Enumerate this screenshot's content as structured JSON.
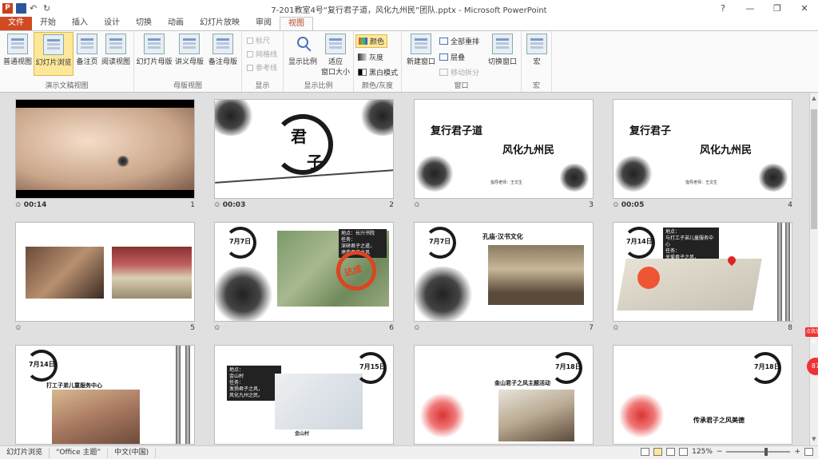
{
  "window": {
    "title": "7-201教室4号“复行君子道，风化九州民”团队.pptx - Microsoft PowerPoint",
    "controls": [
      "?",
      "—",
      "❐",
      "✕"
    ]
  },
  "tabs": [
    {
      "label": "文件"
    },
    {
      "label": "开始"
    },
    {
      "label": "插入"
    },
    {
      "label": "设计"
    },
    {
      "label": "切换"
    },
    {
      "label": "动画"
    },
    {
      "label": "幻灯片放映"
    },
    {
      "label": "审阅"
    },
    {
      "label": "视图"
    }
  ],
  "ribbon": {
    "presentation_views": {
      "label": "演示文稿视图",
      "buttons": [
        "普通视图",
        "幻灯片浏览",
        "备注页",
        "阅读视图"
      ]
    },
    "master_views": {
      "label": "母版视图",
      "buttons": [
        "幻灯片母版",
        "讲义母版",
        "备注母版"
      ]
    },
    "show": {
      "label": "显示",
      "checkboxes": [
        "标尺",
        "网格线",
        "参考线"
      ]
    },
    "zoom": {
      "label": "显示比例",
      "zoom_label": "显示比例",
      "fit_label": "适应",
      "fit_label2": "窗口大小"
    },
    "color": {
      "label": "颜色/灰度",
      "options": [
        "颜色",
        "灰度",
        "黑白模式"
      ]
    },
    "window": {
      "label": "窗口",
      "new_window": "新建窗口",
      "arrange_all": "全部重排",
      "cascade": "层叠",
      "move_split": "移动拆分",
      "switch_line1": "切换窗口"
    },
    "macros": {
      "label": "宏",
      "button": "宏"
    }
  },
  "slides": [
    {
      "number": "5",
      "time": ""
    },
    {
      "number": "1",
      "time": "00:14"
    },
    {
      "number": "2",
      "time": "00:03"
    },
    {
      "number": "3",
      "time": ""
    },
    {
      "number": "4",
      "time": "00:05"
    },
    {
      "number": "6",
      "time": ""
    },
    {
      "number": "7",
      "time": ""
    },
    {
      "number": "8",
      "time": ""
    }
  ],
  "slide_text": {
    "s2_char1": "君",
    "s2_char2": "子",
    "s3_line1": "复行君子道",
    "s3_line2": "风化九州民",
    "s3_small": "指导老师：王文生",
    "s4_line1": "复行君子",
    "s4_line2": "风化九州民",
    "s4_small": "指导老师：王文生",
    "s5_banner": "",
    "s6_date": "7月7日",
    "s6_note": "地点：长兴书院\n任务：\n深研君子之道，\n承传君子之风",
    "s6_stamp": "达成",
    "s7_date": "7月7日",
    "s7_title": "孔庙·汉书文化",
    "s8_date": "7月14日",
    "s8_note": "地点：\n与打工子弟儿童服务中心\n任务：\n关爱君子之风，\n传承中华道德。",
    "s9_date": "7月14日",
    "s9_title": "打工子弟儿童服务中心",
    "s10_note": "地点：\n金山村\n任务：\n发扬君子之风，\n风化九州之民。",
    "s10_date": "7月15日",
    "s10_label": "金山村",
    "s11_date": "7月18日",
    "s11_title": "金山君子之风主题活动",
    "s12_date": "7月18日",
    "s12_title": "传承君子之风美德"
  },
  "statusbar": {
    "view": "幻灯片浏览",
    "theme": "“Office 主题”",
    "language": "中文(中国)",
    "zoom": "125%"
  },
  "floating": {
    "badge": "点我加速",
    "circle": "87"
  },
  "colors": {
    "accent": "#d04b24",
    "ribbon_selected": "#fde89a"
  }
}
